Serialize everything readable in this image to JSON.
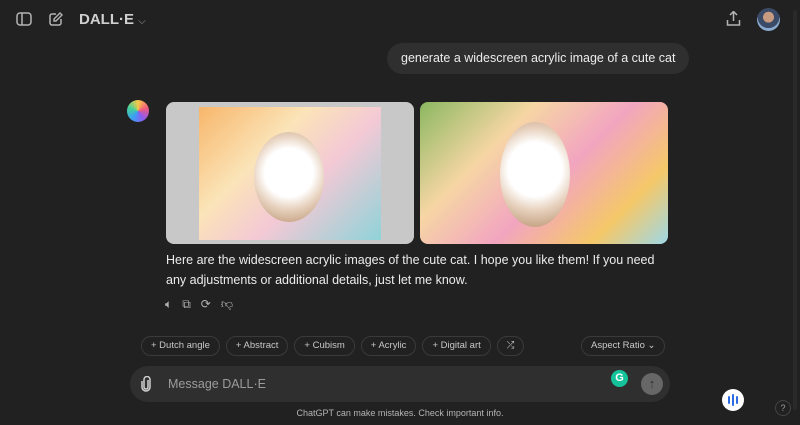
{
  "header": {
    "title": "DALL·E",
    "sidebar_icon": "sidebar-toggle-icon",
    "new_chat_icon": "edit-icon",
    "share_icon": "share-icon"
  },
  "conversation": {
    "user_message": "generate a widescreen acrylic image of a cute cat",
    "assistant_reply": "Here are the widescreen acrylic images of the cute cat. I hope you like them! If you need any adjustments or additional details, just let me know.",
    "actions": [
      "speaker-icon",
      "copy-icon",
      "regenerate-icon",
      "thumbs-down-icon"
    ]
  },
  "chips": [
    {
      "label": "+ Dutch angle"
    },
    {
      "label": "+ Abstract"
    },
    {
      "label": "+ Cubism"
    },
    {
      "label": "+ Acrylic"
    },
    {
      "label": "+ Digital art"
    }
  ],
  "shuffle_label": "⤮",
  "aspect_ratio": "Aspect Ratio ⌄",
  "composer": {
    "placeholder": "Message DALL·E",
    "grammarly": "G",
    "send": "↑"
  },
  "footer": "ChatGPT can make mistakes. Check important info.",
  "help": "?"
}
